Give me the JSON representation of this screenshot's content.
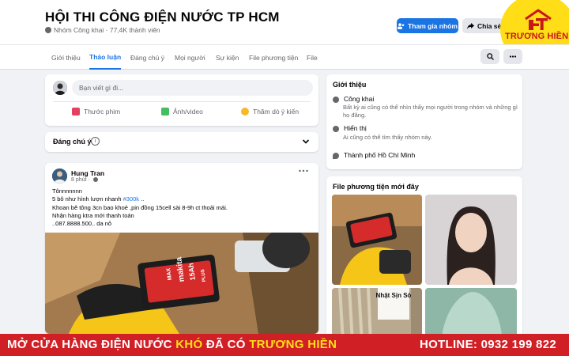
{
  "group": {
    "title": "HỘI THI CÔNG ĐIỆN NƯỚC TP HCM",
    "meta": "Nhóm Công khai · 77,4K thành viên",
    "join_label": "Tham gia nhóm",
    "share_label": "Chia sẻ"
  },
  "logo": {
    "text": "TRƯƠNG HIỀN",
    "color": "#c8161d",
    "badge_color": "#ffde17"
  },
  "tabs": [
    {
      "label": "Giới thiệu"
    },
    {
      "label": "Thảo luận"
    },
    {
      "label": "Đáng chú ý"
    },
    {
      "label": "Mọi người"
    },
    {
      "label": "Sự kiện"
    },
    {
      "label": "File phương tiện"
    },
    {
      "label": "File"
    }
  ],
  "active_tab": "Thảo luận",
  "composer": {
    "placeholder": "Bạn viết gì đi...",
    "actions": [
      {
        "label": "Thước phim",
        "icon": "reel-icon",
        "color": "#e4405f"
      },
      {
        "label": "Ảnh/video",
        "icon": "photo-icon",
        "color": "#45bd62"
      },
      {
        "label": "Thăm dò ý kiến",
        "icon": "poll-icon",
        "color": "#f7b928"
      }
    ]
  },
  "featured": {
    "label": "Đáng chú ý"
  },
  "post": {
    "author": "Hung Tran",
    "time": "8 phút ·",
    "lines": [
      "Tônnnnnnn",
      "5 bô như hình lượn nhanh ",
      "Khoan bê tông 3cn bao khoẻ ,pin đồng 15cell sài 8-9h ct thoải mái.",
      "Nhận hàng ktra mới thanh toán",
      "..087.8888.500.. da nô"
    ],
    "price_tag": "#300k",
    "price_suffix": " ..",
    "image_text": {
      "brand": "makita",
      "spec": "15Ah",
      "model": "MAX",
      "series": "PLUS"
    }
  },
  "intro": {
    "title": "Giới thiệu",
    "public_label": "Công khai",
    "public_desc": "Bất kỳ ai cũng có thể nhìn thấy mọi người trong nhóm và những gì họ đăng.",
    "visible_label": "Hiển thị",
    "visible_desc": "Ai cũng có thể tìm thấy nhóm này.",
    "location": "Thành phố Hồ Chí Minh"
  },
  "media": {
    "title": "File phương tiện mới đây",
    "tile_text": "Nhật Sịn Sò"
  },
  "banner": {
    "left_part1": "MỞ CỬA HÀNG ĐIỆN NƯỚC ",
    "left_highlight1": "KHÓ",
    "left_part2": " ĐÃ CÓ ",
    "left_highlight2": "TRƯƠNG HIỀN",
    "right": "HOTLINE: 0932 199 822"
  },
  "colors": {
    "accent": "#1b74e4",
    "banner_bg": "#d11f26",
    "banner_highlight": "#ffde17"
  }
}
